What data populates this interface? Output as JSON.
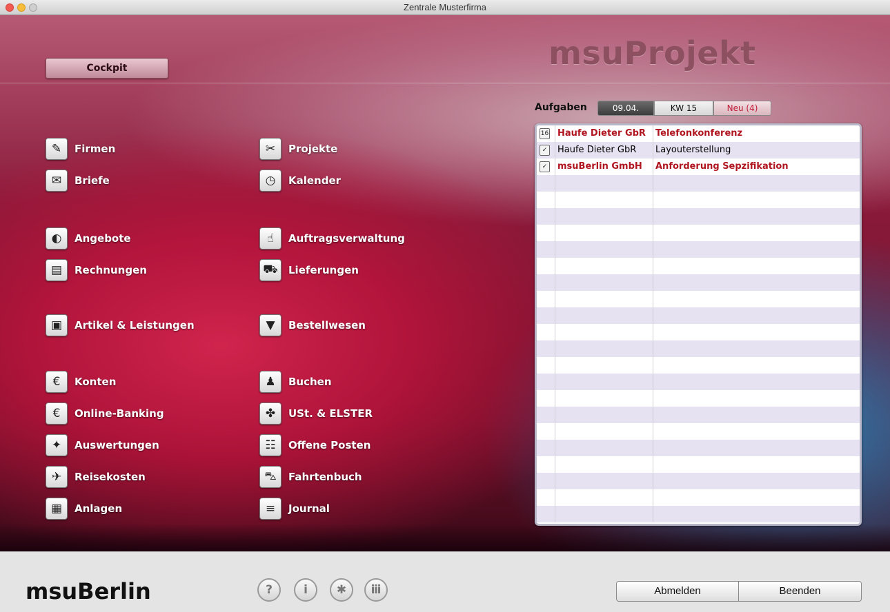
{
  "window": {
    "title": "Zentrale Musterfirma"
  },
  "header": {
    "cockpit_label": "Cockpit",
    "brand": "msuProjekt"
  },
  "nav": {
    "left": [
      {
        "label": "Firmen",
        "icon": "firmen-icon",
        "glyph": "✎"
      },
      {
        "label": "Briefe",
        "icon": "letter-icon",
        "glyph": "✉"
      },
      {
        "label": "Angebote",
        "icon": "offer-icon",
        "glyph": "◐"
      },
      {
        "label": "Rechnungen",
        "icon": "invoice-icon",
        "glyph": "▤"
      },
      {
        "label": "Artikel & Leistungen",
        "icon": "box-icon",
        "glyph": "▣"
      },
      {
        "label": "Konten",
        "icon": "euro-book-icon",
        "glyph": "€"
      },
      {
        "label": "Online-Banking",
        "icon": "euro-coin-icon",
        "glyph": "€"
      },
      {
        "label": "Auswertungen",
        "icon": "eagle-chart-icon",
        "glyph": "✦"
      },
      {
        "label": "Reisekosten",
        "icon": "airplane-icon",
        "glyph": "✈"
      },
      {
        "label": "Anlagen",
        "icon": "assets-icon",
        "glyph": "▦"
      }
    ],
    "right": [
      {
        "label": "Projekte",
        "icon": "project-tools-icon",
        "glyph": "✂"
      },
      {
        "label": "Kalender",
        "icon": "clock-icon",
        "glyph": "◷"
      },
      {
        "label": "Auftragsverwaltung",
        "icon": "handshake-icon",
        "glyph": "☝"
      },
      {
        "label": "Lieferungen",
        "icon": "truck-icon",
        "glyph": "⛟"
      },
      {
        "label": "Bestellwesen",
        "icon": "cart-icon",
        "glyph": "▼"
      },
      {
        "label": "Buchen",
        "icon": "stamp-icon",
        "glyph": "♟"
      },
      {
        "label": "USt. & ELSTER",
        "icon": "eagle-icon",
        "glyph": "✤"
      },
      {
        "label": "Offene Posten",
        "icon": "clipboard-icon",
        "glyph": "☷"
      },
      {
        "label": "Fahrtenbuch",
        "icon": "car-icon",
        "glyph": "⛍"
      },
      {
        "label": "Journal",
        "icon": "journal-icon",
        "glyph": "≡"
      }
    ]
  },
  "tasks": {
    "label": "Aufgaben",
    "tabs": {
      "date": "09.04.",
      "week": "KW 15",
      "new": "Neu (4)"
    },
    "rows": [
      {
        "icon": "calendar-icon",
        "glyph": "16",
        "company": "Haufe Dieter GbR",
        "subject": "Telefonkonferenz",
        "highlight": true
      },
      {
        "icon": "task-icon",
        "glyph": "✓",
        "company": "Haufe Dieter GbR",
        "subject": "Layouterstellung",
        "highlight": false
      },
      {
        "icon": "task-icon",
        "glyph": "✓",
        "company": "msuBerlin GmbH",
        "subject": "Anforderung Sepzifikation",
        "highlight": true
      }
    ],
    "empty_rows": 21
  },
  "footer": {
    "brand": "msuBerlin",
    "help": "?",
    "info": "i",
    "settings": "✱",
    "users": "ⅲ",
    "logout": "Abmelden",
    "quit": "Beenden"
  }
}
